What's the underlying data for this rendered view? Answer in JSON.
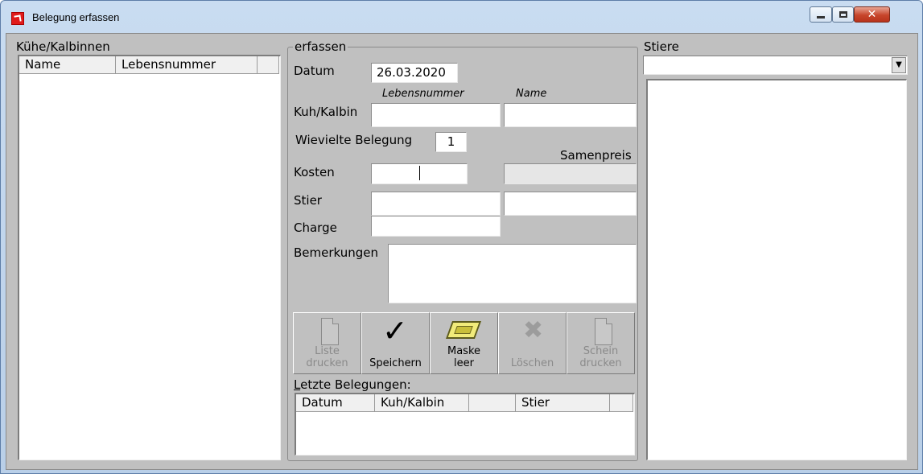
{
  "window": {
    "title": "Belegung erfassen",
    "icons": {
      "app": "app-red-icon",
      "minimize": "minimize-icon",
      "maximize": "maximize-icon",
      "close": "close-icon"
    }
  },
  "left_panel": {
    "title": "Kühe/Kalbinnen",
    "columns": [
      "Name",
      "Lebensnummer"
    ],
    "rows": []
  },
  "form": {
    "frame_title": "erfassen",
    "datum_label": "Datum",
    "datum_value": "26.03.2020",
    "lebensnummer_caption": "Lebensnummer",
    "name_caption": "Name",
    "kuh_label": "Kuh/Kalbin",
    "kuh_lebensnummer_value": "",
    "kuh_name_value": "",
    "belegung_label": "Wievielte Belegung",
    "belegung_value": "1",
    "samenpreis_caption": "Samenpreis",
    "kosten_label": "Kosten",
    "kosten_value": "",
    "samenpreis_value": "",
    "stier_label": "Stier",
    "stier_value": "",
    "stier_name_value": "",
    "charge_label": "Charge",
    "charge_value": "",
    "bemerkungen_label": "Bemerkungen",
    "bemerkungen_value": ""
  },
  "toolbar": {
    "liste_drucken": {
      "line1": "Liste",
      "line2": "drucken",
      "icon": "document-icon",
      "enabled": false
    },
    "speichern": {
      "line1": "Speichern",
      "icon": "checkmark-icon",
      "enabled": true
    },
    "maske_leer": {
      "line1": "Maske",
      "line2": "leer",
      "icon": "tray-icon",
      "enabled": true
    },
    "loeschen": {
      "line1": "Löschen",
      "icon": "delete-x-icon",
      "enabled": false
    },
    "schein_drucken": {
      "line1": "Schein",
      "line2": "drucken",
      "icon": "document-icon",
      "enabled": false
    }
  },
  "recent": {
    "title_first": "L",
    "title_rest": "etzte Belegungen:",
    "columns": [
      "Datum",
      "Kuh/Kalbin",
      "",
      "Stier"
    ],
    "rows": []
  },
  "right_panel": {
    "title": "Stiere",
    "dropdown_value": "",
    "dropdown_icon": "chevron-down-icon",
    "rows": []
  }
}
